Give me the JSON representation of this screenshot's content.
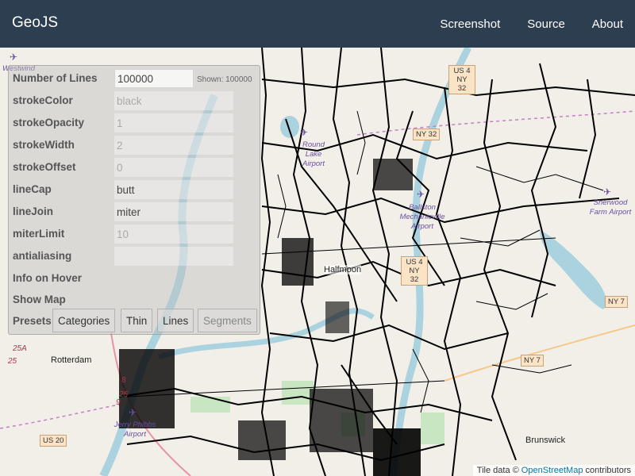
{
  "navbar": {
    "brand": "GeoJS",
    "links": [
      "Screenshot",
      "Source",
      "About"
    ]
  },
  "controls": {
    "number_of_lines": {
      "label": "Number of Lines",
      "value": "100000",
      "shown": "Shown: 100000"
    },
    "stroke_color": {
      "label": "strokeColor",
      "placeholder": "black"
    },
    "stroke_opacity": {
      "label": "strokeOpacity",
      "placeholder": "1"
    },
    "stroke_width": {
      "label": "strokeWidth",
      "placeholder": "2"
    },
    "stroke_offset": {
      "label": "strokeOffset",
      "placeholder": "0"
    },
    "line_cap": {
      "label": "lineCap",
      "value": "butt"
    },
    "line_join": {
      "label": "lineJoin",
      "value": "miter"
    },
    "miter_limit": {
      "label": "miterLimit",
      "placeholder": "10"
    },
    "antialiasing": {
      "label": "antialiasing"
    },
    "info_on_hover": {
      "label": "Info on Hover"
    },
    "show_map": {
      "label": "Show Map"
    },
    "presets": {
      "label": "Presets",
      "buttons": [
        "Categories",
        "Thin",
        "Lines",
        "Segments"
      ]
    }
  },
  "map": {
    "towns": [
      "Rotterdam",
      "Brunswick",
      "Halfmoon"
    ],
    "airports": [
      {
        "name": "Westwind"
      },
      {
        "name": "Round Lake Airport"
      },
      {
        "name": "Sherwood Farm Airport"
      },
      {
        "name": "Ballston Mechanicville Airport"
      },
      {
        "name": "Jerry Phibbs Airport"
      }
    ],
    "shields": [
      "US 4 NY 32",
      "NY 32",
      "US 4 NY 32",
      "NY 7",
      "NY 7",
      "US 20"
    ],
    "routes": [
      "25A",
      "25",
      "8",
      "25",
      "9"
    ]
  },
  "attribution": {
    "prefix": "Tile data ©",
    "link": "OpenStreetMap",
    "suffix": "contributors"
  },
  "colors": {
    "navbar": "#2c3e50",
    "map_background": "#f2efe9",
    "river": "#aad3df",
    "roads": "#000000",
    "link": "#0078a8"
  }
}
